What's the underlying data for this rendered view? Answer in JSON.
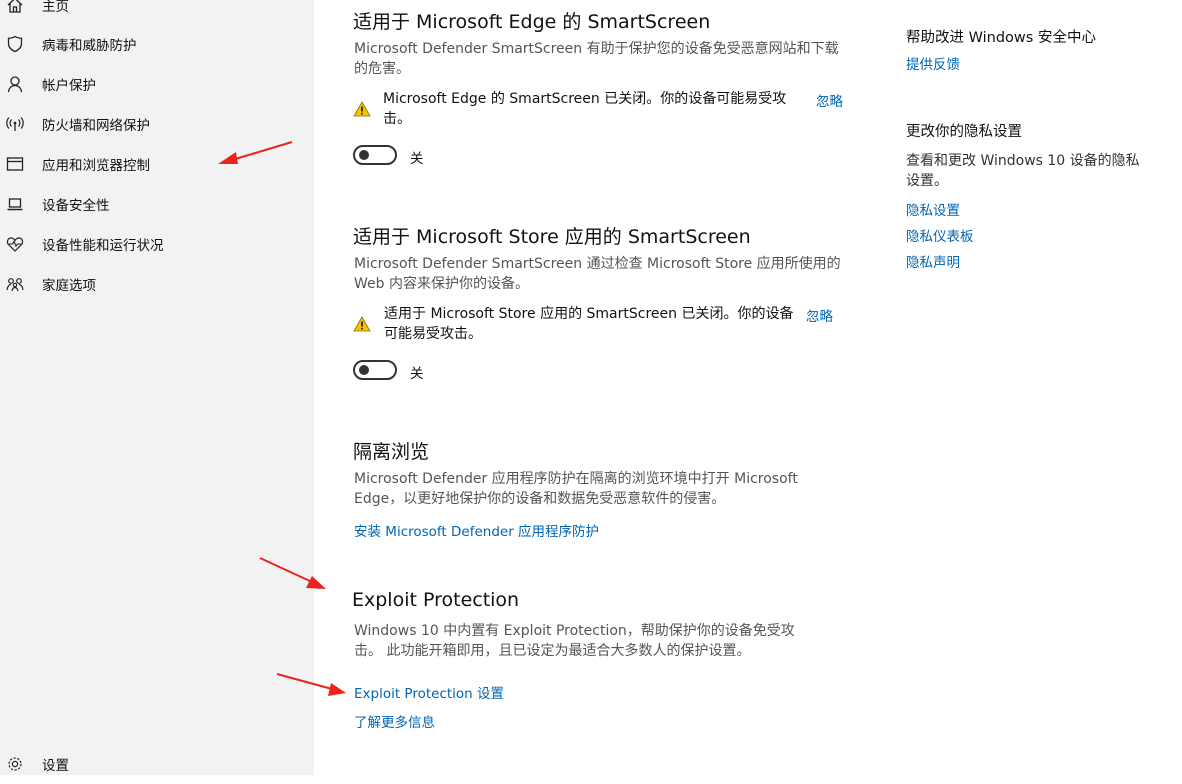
{
  "sidebar": {
    "items": [
      {
        "label": "主页",
        "icon": "home-icon"
      },
      {
        "label": "病毒和威胁防护",
        "icon": "shield-icon"
      },
      {
        "label": "帐户保护",
        "icon": "person-icon"
      },
      {
        "label": "防火墙和网络保护",
        "icon": "wireless-icon"
      },
      {
        "label": "应用和浏览器控制",
        "icon": "app-window-icon"
      },
      {
        "label": "设备安全性",
        "icon": "laptop-icon"
      },
      {
        "label": "设备性能和运行状况",
        "icon": "heart-pulse-icon"
      },
      {
        "label": "家庭选项",
        "icon": "family-icon"
      }
    ],
    "settings_label": "设置",
    "settings_icon": "gear-icon"
  },
  "main": {
    "edge": {
      "title": "适用于 Microsoft Edge 的 SmartScreen",
      "desc_line1": "Microsoft Defender SmartScreen 有助于保护您的设备免受恶意网站和下载",
      "desc_line2": "的危害。",
      "warn_line1": "Microsoft Edge 的 SmartScreen 已关闭。你的设备可能易受攻",
      "warn_line2": "击。",
      "dismiss": "忽略",
      "toggle_label": "关",
      "toggle_on": false
    },
    "store": {
      "title": "适用于 Microsoft Store 应用的 SmartScreen",
      "desc_line1": "Microsoft Defender SmartScreen 通过检查 Microsoft Store 应用所使用的",
      "desc_line2": "Web 内容来保护你的设备。",
      "warn_line1": "适用于 Microsoft Store 应用的 SmartScreen 已关闭。你的设备",
      "warn_line2": "可能易受攻击。",
      "dismiss": "忽略",
      "toggle_label": "关",
      "toggle_on": false
    },
    "isolated": {
      "title": "隔离浏览",
      "desc_line1": "Microsoft Defender 应用程序防护在隔离的浏览环境中打开 Microsoft",
      "desc_line2": "Edge，以更好地保护你的设备和数据免受恶意软件的侵害。",
      "link": "安装 Microsoft Defender 应用程序防护"
    },
    "exploit": {
      "title": "Exploit Protection",
      "desc_line1": "Windows 10 中内置有 Exploit Protection，帮助保护你的设备免受攻",
      "desc_line2": "击。 此功能开箱即用，且已设定为最适合大多数人的保护设置。",
      "settings_link": "Exploit Protection 设置",
      "learn_more": "了解更多信息"
    }
  },
  "right_panel": {
    "improve_title": "帮助改进 Windows 安全中心",
    "feedback_link": "提供反馈",
    "privacy_title": "更改你的隐私设置",
    "privacy_desc_line1": "查看和更改 Windows 10 设备的隐私",
    "privacy_desc_line2": "设置。",
    "privacy_links": [
      "隐私设置",
      "隐私仪表板",
      "隐私声明"
    ]
  },
  "colors": {
    "sidebar_bg": "#f2f2f2",
    "link": "#0066b4",
    "warning": "#f5c400",
    "annotation_arrow": "#e8241c"
  }
}
